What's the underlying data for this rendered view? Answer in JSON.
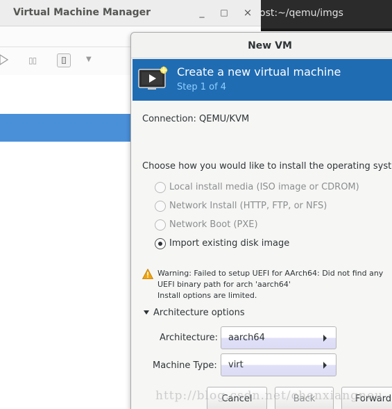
{
  "background": {
    "terminal_title": "ost:~/qemu/imgs",
    "vmm_window": {
      "title": "Virtual Machine Manager",
      "minimize_glyph": "_",
      "maximize_glyph": "□",
      "close_glyph": "×",
      "toolbar_icons": [
        "play-icon",
        "pause-icon",
        "stop-icon",
        "chevron-down-icon"
      ]
    }
  },
  "dialog": {
    "title": "New VM",
    "header": {
      "title": "Create a new virtual machine",
      "step": "Step 1 of 4",
      "icon": "new-vm-monitor-icon"
    },
    "connection_label": "Connection:",
    "connection_value": "QEMU/KVM",
    "install_prompt": "Choose how you would like to install the operating syste",
    "install_options": [
      {
        "label": "Local install media (ISO image or CDROM)",
        "selected": false,
        "enabled": false
      },
      {
        "label": "Network Install (HTTP, FTP, or NFS)",
        "selected": false,
        "enabled": false
      },
      {
        "label": "Network Boot (PXE)",
        "selected": false,
        "enabled": false
      },
      {
        "label": "Import existing disk image",
        "selected": true,
        "enabled": true
      }
    ],
    "warning": {
      "icon": "warning-icon",
      "line1": "Warning: Failed to setup UEFI for AArch64: Did not find any",
      "line2": "UEFI binary path for arch 'aarch64'",
      "line3": "Install options are limited."
    },
    "arch_options": {
      "expander_label": "Architecture options",
      "expanded": true,
      "architecture_label": "Architecture:",
      "architecture_value": "aarch64",
      "machine_type_label": "Machine Type:",
      "machine_type_value": "virt"
    },
    "buttons": {
      "cancel": "Cancel",
      "back": "Back",
      "forward": "Forward"
    }
  },
  "watermark": "http://blog.csdn.net/chenxiangneu",
  "colors": {
    "header_blue": "#1f6cb3",
    "step_text": "#8fd0ff",
    "selection_blue": "#4a90d9",
    "warning_orange": "#f0a30a"
  }
}
